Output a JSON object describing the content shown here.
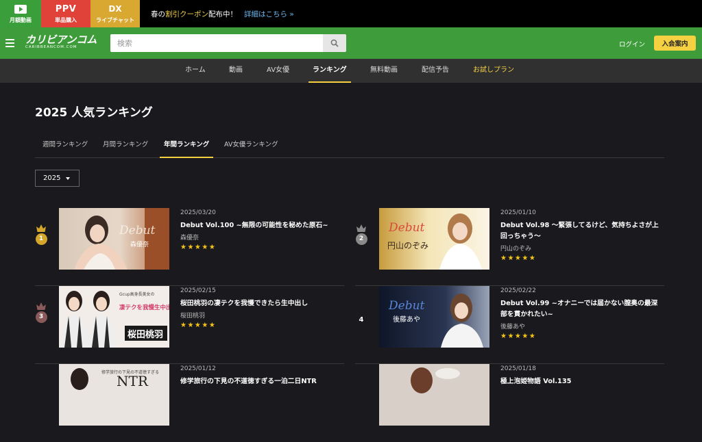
{
  "topbar": {
    "services": [
      {
        "label": "月額動画",
        "icon": "play-icon"
      },
      {
        "label": "単品購入",
        "icon_text": "PPV"
      },
      {
        "label": "ライブチャット",
        "icon_text": "DX"
      }
    ],
    "promo": {
      "prefix": "春の",
      "highlight": "割引クーポン",
      "suffix": "配布中！",
      "link": "詳細はこちら »"
    }
  },
  "header": {
    "logo_main": "カリビアンコム",
    "logo_sub": "CARIBBEANCOM.COM",
    "search_placeholder": "検索",
    "login": "ログイン",
    "join": "入会案内"
  },
  "nav": [
    "ホーム",
    "動画",
    "AV女優",
    "ランキング",
    "無料動画",
    "配信予告",
    "お試しプラン"
  ],
  "page": {
    "title": "2025 人気ランキング",
    "tabs": [
      "週間ランキング",
      "月間ランキング",
      "年間ランキング",
      "AV女優ランキング"
    ],
    "year": "2025"
  },
  "rankings": [
    {
      "rank": "1",
      "date": "2025/03/20",
      "title": "Debut Vol.100 ~無限の可能性を秘めた原石~",
      "actress": "森優奈",
      "stars": "★★★★★",
      "thumb_text": "Debut",
      "thumb_name": "森優奈"
    },
    {
      "rank": "2",
      "date": "2025/01/10",
      "title": "Debut Vol.98 〜緊張してるけど、気持ちよさが上回っちゃう〜",
      "actress": "円山のぞみ",
      "stars": "★★★★★",
      "thumb_text": "Debut",
      "thumb_name": "円山のぞみ"
    },
    {
      "rank": "3",
      "date": "2025/02/15",
      "title": "桜田桃羽の凄テクを我慢できたら生中出し",
      "actress": "桜田桃羽",
      "stars": "★★★★★",
      "thumb_text": "凄テクを我慢生中出し",
      "thumb_name": "桜田桃羽"
    },
    {
      "rank": "4",
      "date": "2025/02/22",
      "title": "Debut Vol.99 ~オナニーでは届かない膣奥の最深部を貫かれたい~",
      "actress": "後藤あや",
      "stars": "★★★★★",
      "thumb_text": "Debut",
      "thumb_name": "後藤あや"
    },
    {
      "rank": "",
      "date": "2025/01/12",
      "title": "修学旅行の下見の不道徳すぎる一泊二日NTR",
      "actress": "",
      "stars": "",
      "thumb_text": "NTR",
      "thumb_name": ""
    },
    {
      "rank": "",
      "date": "2025/01/18",
      "title": "極上泡姫物語 Vol.135",
      "actress": "",
      "stars": "",
      "thumb_text": "",
      "thumb_name": ""
    }
  ]
}
